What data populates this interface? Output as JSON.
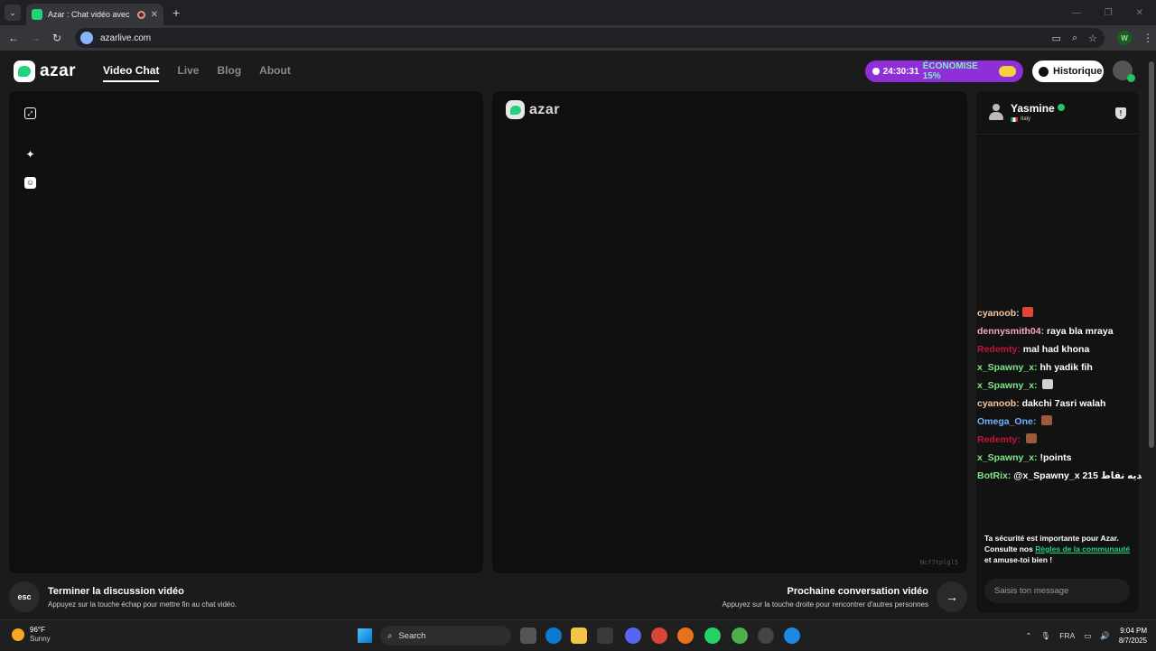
{
  "browser": {
    "tab_title": "Azar : Chat vidéo avec de n",
    "url": "azarlive.com"
  },
  "header": {
    "brand": "azar",
    "nav": [
      "Video Chat",
      "Live",
      "Blog",
      "About"
    ],
    "promo_timer": "24:30:31",
    "promo_discount": "ÉCONOMISE 15%",
    "history_label": "Historique"
  },
  "remote_panel": {
    "brand": "azar",
    "session_id": "Ncf7tplgl5"
  },
  "controls": {
    "esc_label": "esc",
    "end_title": "Terminer la discussion vidéo",
    "end_hint": "Appuyez sur la touche échap pour mettre fin au chat vidéo.",
    "next_title": "Prochaine conversation vidéo",
    "next_hint": "Appuyez sur la touche droite pour rencontrer d'autres personnes"
  },
  "chat": {
    "partner_name": "Yasmine",
    "partner_country": "Italy",
    "messages": [
      {
        "user": "cyanoob:",
        "text": "",
        "user_color": "#f5c6a0",
        "emote_color": "#e0453a"
      },
      {
        "user": "dennysmith04:",
        "text": " raya bla mraya",
        "user_color": "#f8a5c2"
      },
      {
        "user": "Redemty:",
        "text": " mal had khona",
        "user_color": "#c0163c"
      },
      {
        "user": "x_Spawny_x:",
        "text": " hh yadik fih",
        "user_color": "#7ee787"
      },
      {
        "user": "x_Spawny_x:",
        "text": " ",
        "user_color": "#7ee787",
        "emote_color": "#d0d0d0"
      },
      {
        "user": "cyanoob:",
        "text": " dakchi 7asri walah",
        "user_color": "#f5c6a0"
      },
      {
        "user": "Omega_One:",
        "text": " ",
        "user_color": "#6fb6ff",
        "emote_color": "#9c5a3c"
      },
      {
        "user": "Redemty:",
        "text": " ",
        "user_color": "#c0163c",
        "emote_color": "#9c5a3c"
      },
      {
        "user": "x_Spawny_x:",
        "text": " !points",
        "user_color": "#7ee787"
      },
      {
        "user": "BotRix:",
        "text": " @x_Spawny_x 215 لديه نقاط",
        "user_color": "#7ee787"
      }
    ],
    "safety_text_1": "Ta sécurité est importante pour Azar. Consulte nos ",
    "safety_link": "Règles de la communauté",
    "safety_text_2": " et amuse-toi bien !",
    "input_placeholder": "Saisis ton message"
  },
  "taskbar": {
    "temp": "96°F",
    "condition": "Sunny",
    "search": "Search",
    "lang": "FRA",
    "time": "9:04 PM",
    "date": "8/7/2025"
  }
}
